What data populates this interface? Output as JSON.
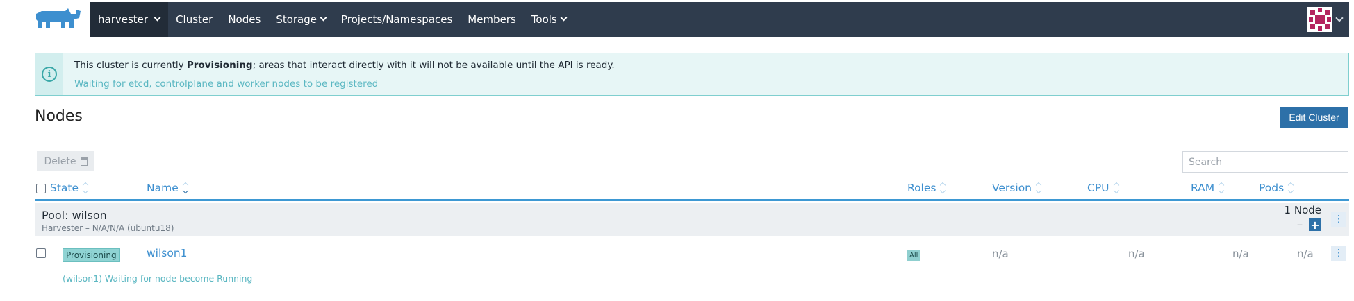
{
  "header": {
    "cluster_name": "harvester",
    "nav": [
      "Cluster",
      "Nodes",
      "Storage",
      "Projects/Namespaces",
      "Members",
      "Tools"
    ]
  },
  "banner": {
    "prefix": "This cluster is currently ",
    "state": "Provisioning",
    "suffix": "; areas that interact directly with it will not be available until the API is ready.",
    "detail": "Waiting for etcd, controlplane and worker nodes to be registered"
  },
  "page": {
    "title": "Nodes",
    "edit_button": "Edit Cluster",
    "delete_button": "Delete",
    "search_placeholder": "Search"
  },
  "table": {
    "columns": [
      "State",
      "Name",
      "Roles",
      "Version",
      "CPU",
      "RAM",
      "Pods"
    ],
    "pool": {
      "name": "Pool: wilson",
      "subtitle": "Harvester – N/A/N/A (ubuntu18)",
      "count": "1 Node",
      "minus": "–",
      "plus": "+"
    },
    "rows": [
      {
        "state": "Provisioning",
        "name": "wilson1",
        "role": "All",
        "version": "n/a",
        "cpu": "n/a",
        "ram": "n/a",
        "pods": "n/a",
        "message": "(wilson1) Waiting for node become Running"
      }
    ]
  },
  "colors": {
    "navbar": "#2f3c4d",
    "navbar_active": "#222c38",
    "accent": "#2d70a8",
    "link": "#3d8fcf",
    "banner_bg": "#e7f6f6",
    "state_badge": "#8fd3d3",
    "logo": "#3d8fcf"
  },
  "icons": {
    "logo": "rancher-logo",
    "info": "info-icon",
    "trash": "trash-icon",
    "sort": "sort-icon",
    "kebab": "kebab-menu-icon",
    "avatar": "user-avatar"
  }
}
